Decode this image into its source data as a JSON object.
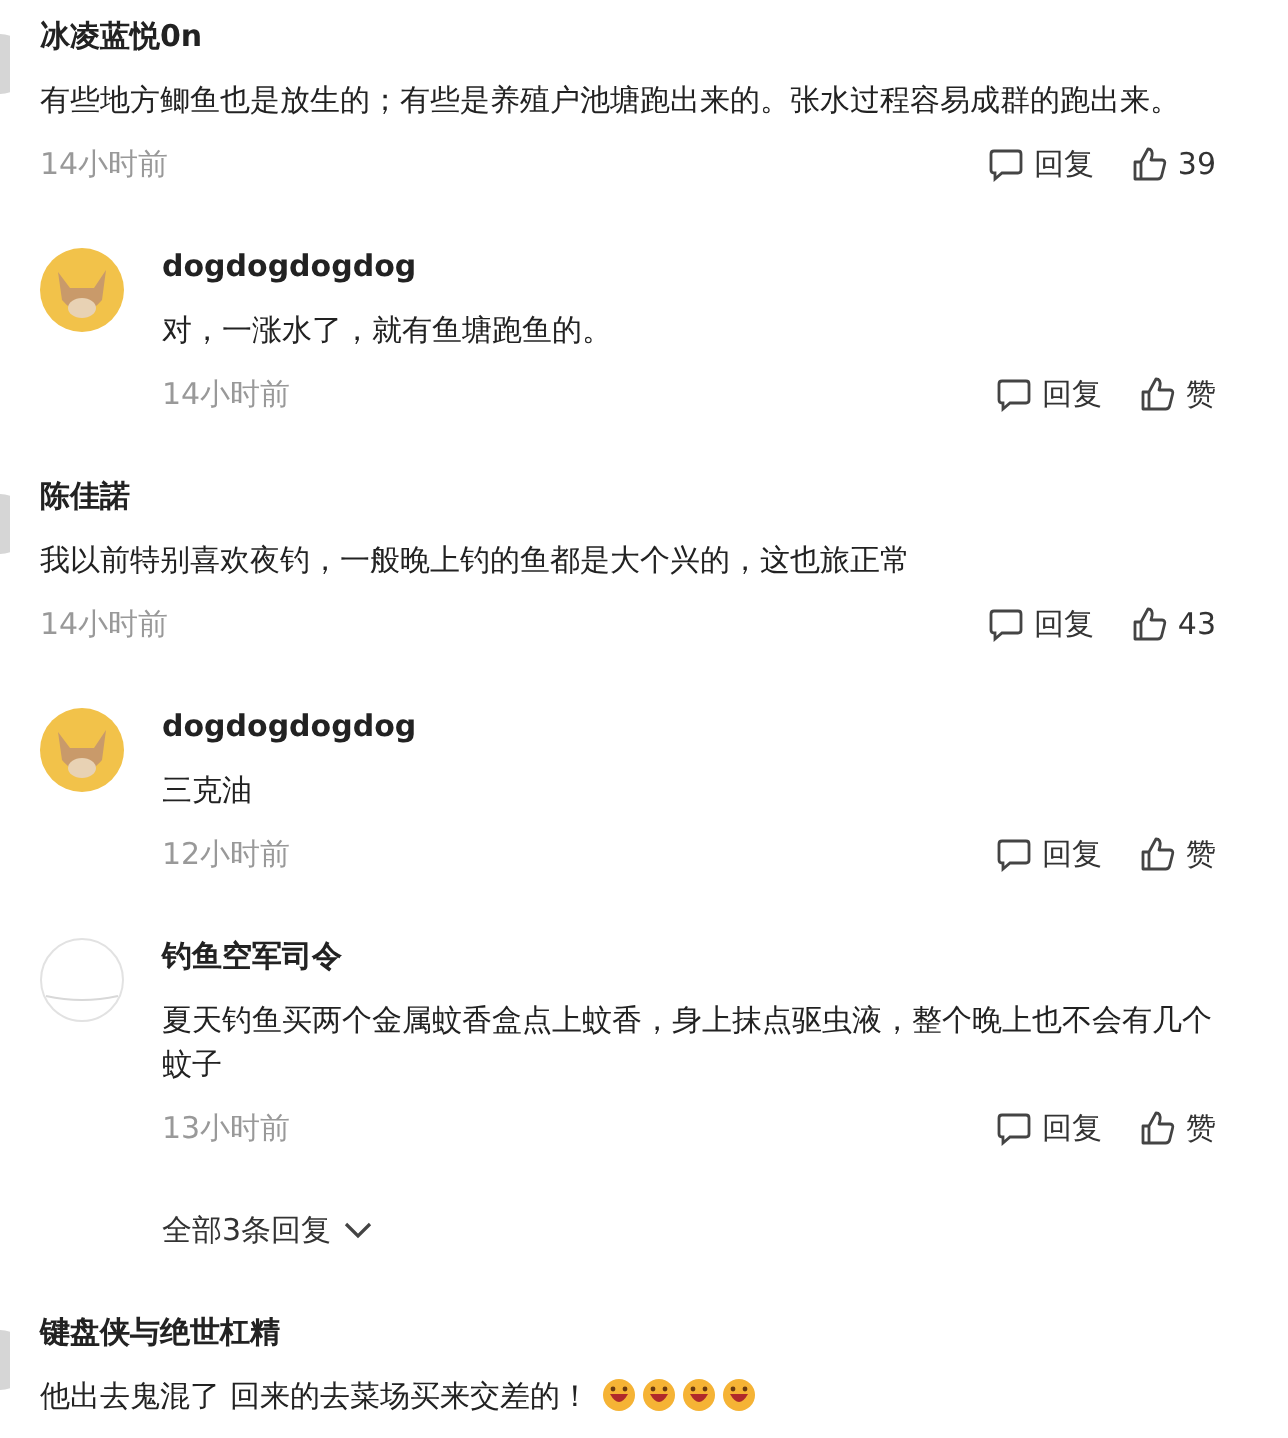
{
  "items": [
    {
      "kind": "comment",
      "avatar": {
        "kind": "edge"
      },
      "author": "冰凌蓝悦0n",
      "text": "有些地方鲫鱼也是放生的；有些是养殖户池塘跑出来的。张水过程容易成群的跑出来。",
      "time": "14小时前",
      "reply_label": "回复",
      "likes": "39"
    },
    {
      "kind": "reply",
      "avatar": {
        "kind": "dog"
      },
      "author": "dogdogdogdog",
      "text": "对，一涨水了，就有鱼塘跑鱼的。",
      "time": "14小时前",
      "reply_label": "回复",
      "likes": "赞"
    },
    {
      "kind": "comment",
      "avatar": {
        "kind": "edge"
      },
      "author": "陈佳諾",
      "text": "我以前特别喜欢夜钓，一般晚上钓的鱼都是大个兴的，这也旅正常",
      "time": "14小时前",
      "reply_label": "回复",
      "likes": "43"
    },
    {
      "kind": "reply",
      "avatar": {
        "kind": "dog"
      },
      "author": "dogdogdogdog",
      "text": "三克油",
      "time": "12小时前",
      "reply_label": "回复",
      "likes": "赞"
    },
    {
      "kind": "reply",
      "avatar": {
        "kind": "blank"
      },
      "author": "钓鱼空军司令",
      "text": "夏天钓鱼买两个金属蚊香盒点上蚊香，身上抹点驱虫液，整个晚上也不会有几个蚊子",
      "time": "13小时前",
      "reply_label": "回复",
      "likes": "赞"
    },
    {
      "kind": "more",
      "label": "全部3条回复"
    },
    {
      "kind": "comment",
      "avatar": {
        "kind": "edge"
      },
      "author": "键盘侠与绝世杠精",
      "text": "他出去鬼混了 回来的去菜场买来交差的！",
      "emojis": [
        {
          "kind": "laugh"
        },
        {
          "kind": "laugh"
        },
        {
          "kind": "laugh"
        },
        {
          "kind": "laugh"
        }
      ]
    }
  ]
}
